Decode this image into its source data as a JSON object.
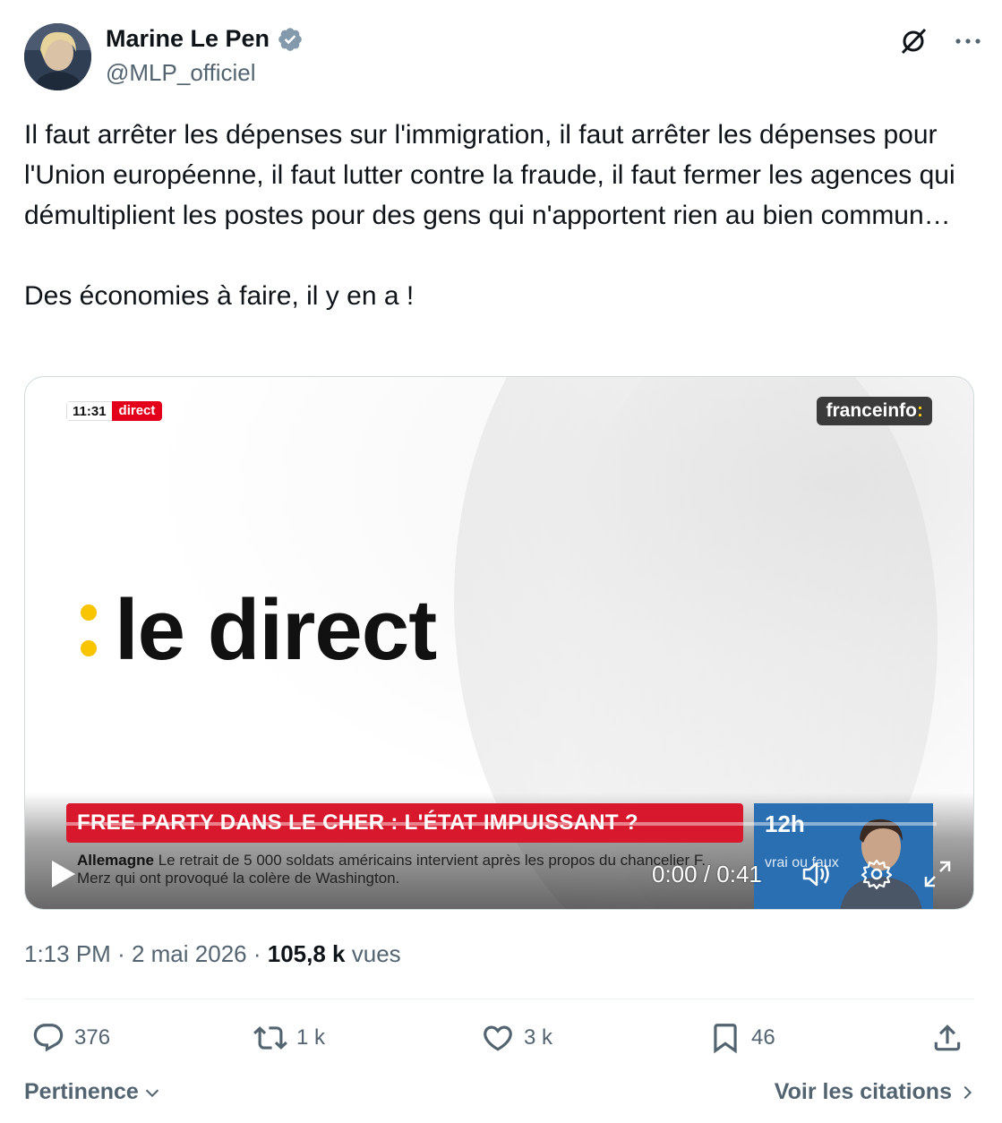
{
  "author": {
    "name": "Marine Le Pen",
    "handle": "@MLP_officiel",
    "verified": true,
    "avatar_icon": "person-photo"
  },
  "tweet": {
    "paragraph1": "Il faut arrêter les dépenses sur l'immigration, il faut arrêter les dépenses pour l'Union européenne, il faut lutter contre la fraude, il faut fermer les agences qui démultiplient les postes pour des gens qui n'apportent rien au bien commun…",
    "paragraph2": "Des économies à faire, il y en a !"
  },
  "video": {
    "live_time": "11:31",
    "live_label": "direct",
    "brand": "franceinfo",
    "brand_colon": ":",
    "title": "le direct",
    "headline": "FREE PARTY DANS LE CHER : L'ÉTAT IMPUISSANT ?",
    "ticker_title": "Allemagne",
    "ticker_text": "Le retrait de 5 000 soldats américains intervient après les propos du chancelier F. Merz qui ont provoqué la colère de Washington.",
    "side_hour": "12h",
    "side_text": "vrai ou faux",
    "timecode": "0:00 / 0:41",
    "progress": 0,
    "accent_red": "#d8182c",
    "accent_yellow": "#f9c400"
  },
  "meta": {
    "time": "1:13 PM",
    "separator": "·",
    "date": "2 mai 2026",
    "views_count": "105,8 k",
    "views_label": "vues"
  },
  "actions": {
    "replies": "376",
    "reposts": "1 k",
    "likes": "3 k",
    "bookmarks": "46"
  },
  "footer": {
    "sort_label": "Pertinence",
    "quotes_label": "Voir les citations"
  }
}
